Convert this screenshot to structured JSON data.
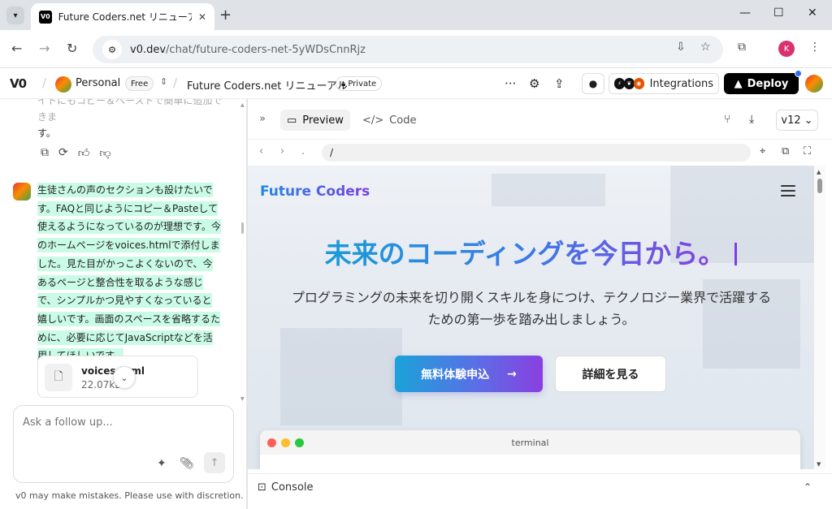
{
  "browser": {
    "tab_title": "Future Coders.net リニューアル - v",
    "tab_favicon": "V0",
    "url_host": "v0.dev",
    "url_path": "/chat/future-coders-net-5yWDsCnnRjz",
    "profile_initial": "K"
  },
  "header": {
    "logo": "V0",
    "workspace": "Personal",
    "plan_badge": "Free",
    "project_name": "Future Coders.net リニューアル",
    "visibility": "Private",
    "integrations_label": "Integrations",
    "deploy_label": "Deploy"
  },
  "chat": {
    "prev_message_faded": "イトにもコピー＆ペーストで簡単に追加できま",
    "prev_message_end": "す。",
    "user_message": "生徒さんの声のセクションも設けたいです。FAQと同じようにコピー＆Pasteして使えるようになっているのが理想です。今のホームページをvoices.htmlで添付しました。見た目がかっこよくないので、今あるページと整合性を取るような感じで、シンプルかつ見やすくなっていると嬉しいです。画面のスペースを省略するために、必要に応じてJavaScriptなどを活用してほしいです。",
    "attachment_name": "voices.html",
    "attachment_size": "22.07kB",
    "composer_placeholder": "Ask a follow up...",
    "disclaimer": "v0 may make mistakes. Please use with discretion."
  },
  "preview": {
    "tab_preview": "Preview",
    "tab_code": "Code",
    "version": "v12",
    "path": "/",
    "console_label": "Console"
  },
  "site": {
    "brand": "Future Coders",
    "headline": "未来のコーディングを今日から。",
    "subline1": "プログラミングの未来を切り開くスキルを身につけ、テクノロジー業界で活躍する",
    "subline2": "ための第一歩を踏み出しましょう。",
    "cta_primary": "無料体験申込",
    "cta_secondary": "詳細を見る",
    "terminal_title": "terminal"
  },
  "colors": {
    "highlight": "#c9fbe6",
    "gradient_start": "#1a9bd7",
    "gradient_end": "#8a3fe0",
    "deploy_bg": "#000000"
  }
}
